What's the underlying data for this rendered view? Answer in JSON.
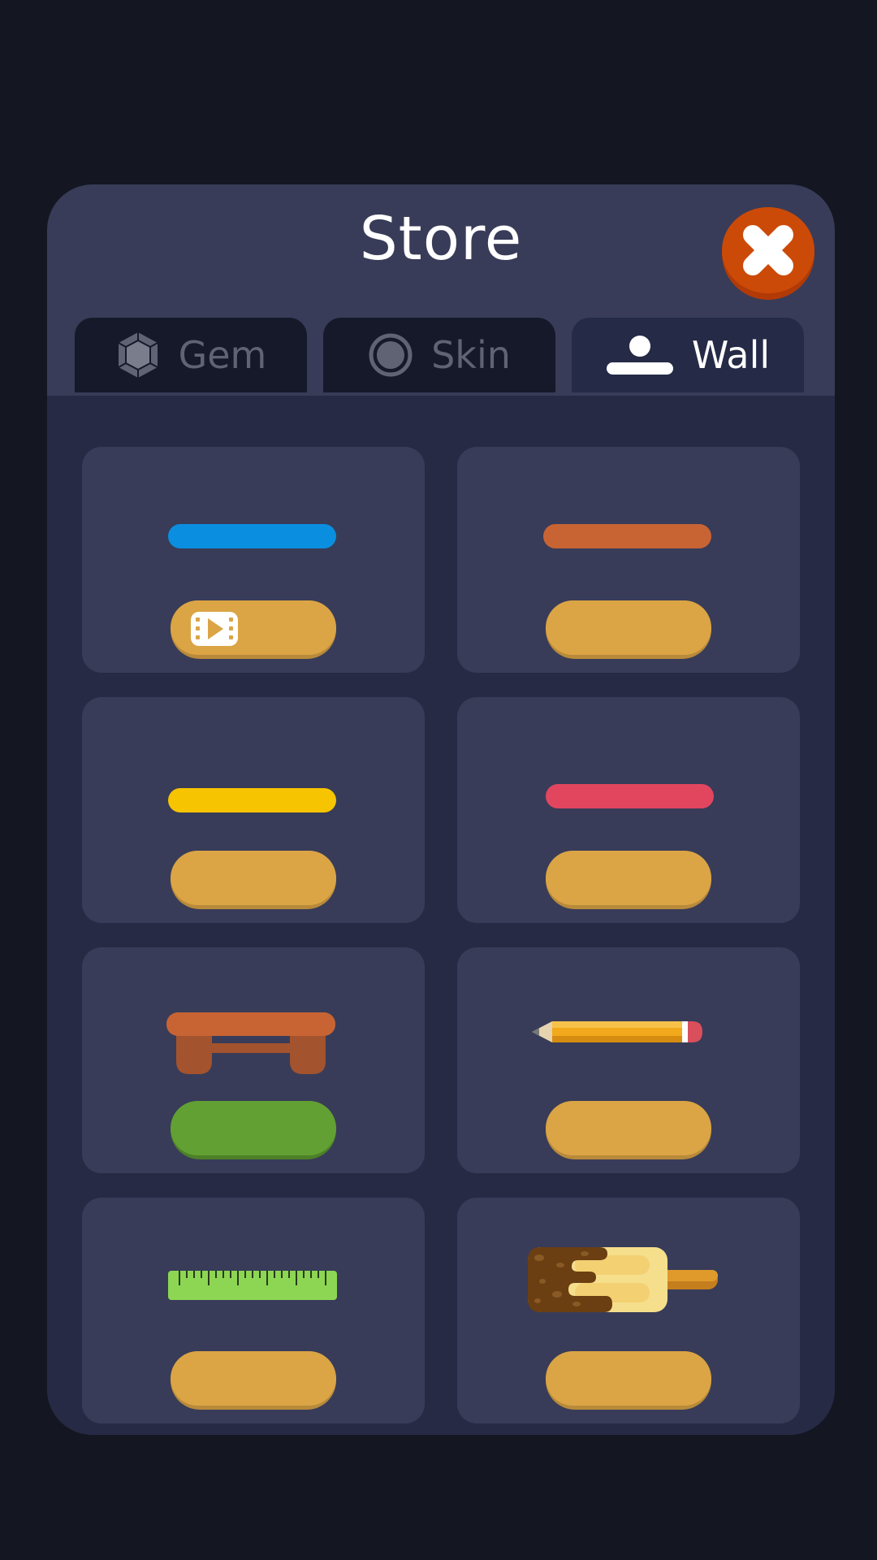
{
  "title": "Store",
  "close_button": {
    "icon": "close-icon"
  },
  "tabs": [
    {
      "label": "Gem",
      "icon": "gem-icon",
      "active": false
    },
    {
      "label": "Skin",
      "icon": "skin-icon",
      "active": false
    },
    {
      "label": "Wall",
      "icon": "wall-icon",
      "active": true
    }
  ],
  "items": [
    {
      "name": "blue wall",
      "color": "#0a8fe0",
      "button": "watch video",
      "button_icon": "video-icon"
    },
    {
      "name": "orange wall",
      "color": "#c86434",
      "button": "locked"
    },
    {
      "name": "yellow wall",
      "color": "#f6c400",
      "button": "locked"
    },
    {
      "name": "red wall",
      "color": "#e2465f",
      "button": "locked"
    },
    {
      "name": "wooden bench wall",
      "color": "#c86434",
      "button": "equipped"
    },
    {
      "name": "pencil wall",
      "color": "#f3a91c",
      "button": "locked"
    },
    {
      "name": "ruler wall",
      "color": "#8cd653",
      "button": "locked"
    },
    {
      "name": "popsicle wall",
      "color": "#f6df8c",
      "button": "locked"
    }
  ]
}
